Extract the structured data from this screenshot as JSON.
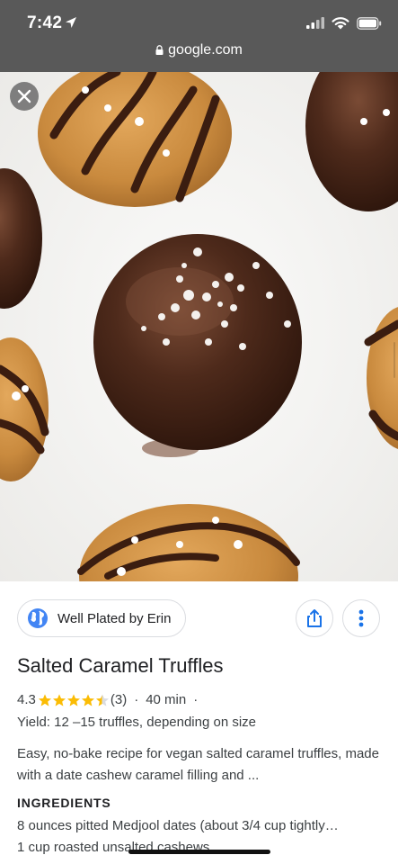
{
  "status_bar": {
    "time": "7:42",
    "url": "google.com"
  },
  "hero": {
    "image": "salted-caramel-truffles-photo",
    "close_icon": "close-icon"
  },
  "source": {
    "name": "Well Plated by Erin",
    "icon": "globe-icon"
  },
  "actions": {
    "share_icon": "share-icon",
    "more_icon": "more-vert-icon"
  },
  "recipe": {
    "title": "Salted Caramel Truffles",
    "rating": "4.3",
    "stars": 4.3,
    "review_count": "(3)",
    "separator": "·",
    "time": "40 min",
    "yield": "Yield: 12 –15 truffles, depending on size",
    "description": "Easy, no-bake recipe for vegan salted caramel truffles, made with a date cashew caramel filling and ...",
    "ingredients_heading": "INGREDIENTS",
    "ingredients": [
      "8 ounces pitted Medjool dates (about 3/4 cup tightly…",
      "1 cup roasted unsalted cashews"
    ]
  },
  "colors": {
    "status_bar": "#595959",
    "star": "#fbbc04",
    "globe": "#4285f4",
    "action_icon": "#1a73e8"
  }
}
